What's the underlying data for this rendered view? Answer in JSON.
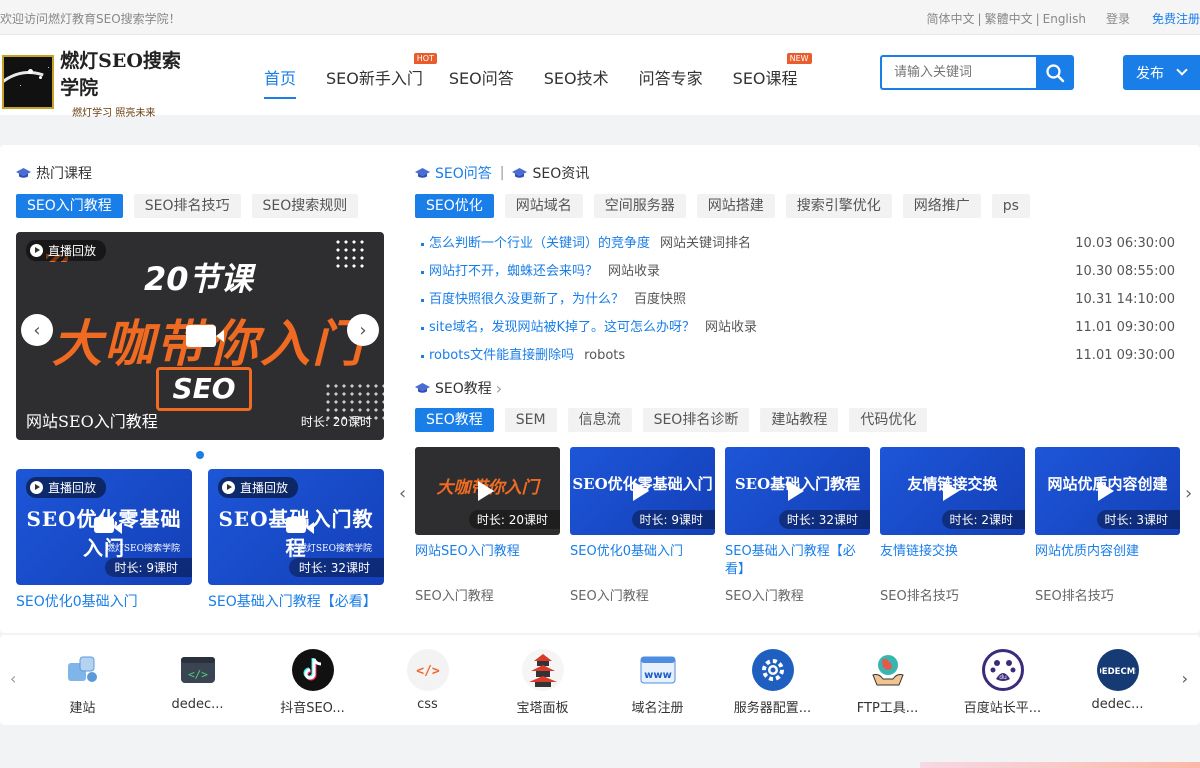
{
  "topbar": {
    "welcome": "欢迎访问燃灯教育SEO搜索学院！",
    "lang_simplified": "简体中文",
    "lang_traditional": "繁體中文",
    "lang_english": "English",
    "login": "登录",
    "register": "免费注册"
  },
  "header": {
    "logo_title": "燃灯SEO搜索学院",
    "logo_sub": "燃灯学习 照亮未来",
    "nav": [
      {
        "label": "首页",
        "badge": ""
      },
      {
        "label": "SEO新手入门",
        "badge": "HOT"
      },
      {
        "label": "SEO问答",
        "badge": ""
      },
      {
        "label": "SEO技术",
        "badge": ""
      },
      {
        "label": "问答专家",
        "badge": ""
      },
      {
        "label": "SEO课程",
        "badge": "NEW"
      }
    ],
    "search_placeholder": "请输入关键词",
    "publish": "发布"
  },
  "hot": {
    "title": "热门课程",
    "tabs": [
      "SEO入门教程",
      "SEO排名技巧",
      "SEO搜索规则"
    ],
    "banner": {
      "live": "直播回放",
      "sub": "20节课",
      "main": "大咖带你入门",
      "seo": "SEO",
      "caption": "网站SEO入门教程",
      "duration": "时长: 20课时"
    },
    "cards": [
      {
        "live": "直播回放",
        "thumb_text": "SEO优化零基础入门",
        "thumb_sub": "燃灯SEO搜索学院",
        "duration": "时长: 9课时",
        "title": "SEO优化0基础入门"
      },
      {
        "live": "直播回放",
        "thumb_text": "SEO基础入门教程",
        "thumb_sub": "燃灯SEO搜索学院",
        "duration": "时长: 32课时",
        "title": "SEO基础入门教程【必看】"
      }
    ]
  },
  "qa": {
    "title1": "SEO问答",
    "title2": "SEO资讯",
    "tabs": [
      "SEO优化",
      "网站域名",
      "空间服务器",
      "网站搭建",
      "搜索引擎优化",
      "网络推广",
      "ps"
    ],
    "rows": [
      {
        "q": "怎么判断一个行业（关键词）的竞争度",
        "cat": "网站关键词排名",
        "time": "10.03 06:30:00"
      },
      {
        "q": "网站打不开，蜘蛛还会来吗？",
        "cat": "网站收录",
        "time": "10.30 08:55:00"
      },
      {
        "q": "百度快照很久没更新了，为什么？",
        "cat": "百度快照",
        "time": "10.31 14:10:00"
      },
      {
        "q": "site域名，发现网站被K掉了。这可怎么办呀？",
        "cat": "网站收录",
        "time": "11.01 09:30:00"
      },
      {
        "q": "robots文件能直接删除吗",
        "cat": "robots",
        "time": "11.01 09:30:00"
      }
    ]
  },
  "course": {
    "title": "SEO教程",
    "tabs": [
      "SEO教程",
      "SEM",
      "信息流",
      "SEO排名诊断",
      "建站教程",
      "代码优化"
    ],
    "cards": [
      {
        "thumb_text": "大咖带你入门",
        "duration": "时长: 20课时",
        "title": "网站SEO入门教程",
        "cat": "SEO入门教程"
      },
      {
        "thumb_text": "SEO优化零基础入门",
        "duration": "时长: 9课时",
        "title": "SEO优化0基础入门",
        "cat": "SEO入门教程"
      },
      {
        "thumb_text": "SEO基础入门教程",
        "duration": "时长: 32课时",
        "title": "SEO基础入门教程【必看】",
        "cat": "SEO入门教程"
      },
      {
        "thumb_text": "友情链接交换",
        "duration": "时长: 2课时",
        "title": "友情链接交换",
        "cat": "SEO排名技巧"
      },
      {
        "thumb_text": "网站优质内容创建",
        "duration": "时长: 3课时",
        "title": "网站优质内容创建",
        "cat": "SEO排名技巧"
      }
    ]
  },
  "tools": [
    {
      "name": "建站",
      "icon": "website-build-icon"
    },
    {
      "name": "dedec...",
      "icon": "code-window-icon"
    },
    {
      "name": "抖音SEO...",
      "icon": "tiktok-icon"
    },
    {
      "name": "css",
      "icon": "css-icon"
    },
    {
      "name": "宝塔面板",
      "icon": "pagoda-icon"
    },
    {
      "name": "域名注册",
      "icon": "www-icon"
    },
    {
      "name": "服务器配置...",
      "icon": "gear-icon"
    },
    {
      "name": "FTP工具...",
      "icon": "globe-hands-icon"
    },
    {
      "name": "百度站长平...",
      "icon": "baidu-paw-icon"
    },
    {
      "name": "dedec...",
      "icon": "dedecms-icon"
    }
  ],
  "colors": {
    "accent": "#1a7ee8",
    "badge": "#e85d2b",
    "banner_orange": "#f06a22"
  }
}
